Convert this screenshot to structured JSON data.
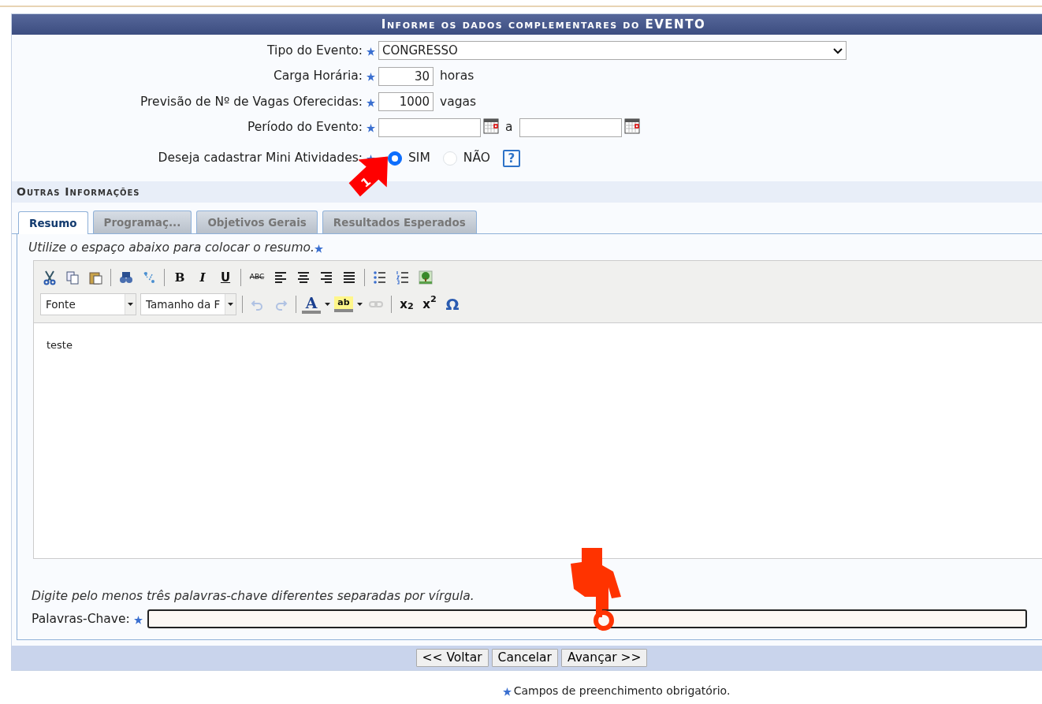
{
  "header": {
    "title": "Informe os dados complementares do EVENTO"
  },
  "fields": [
    {
      "kind": "select",
      "label": "Tipo do Evento:",
      "value": "CONGRESSO"
    },
    {
      "kind": "number",
      "label": "Carga Horária:",
      "value": "30",
      "unit": "horas"
    },
    {
      "kind": "number",
      "label": "Previsão de Nº de Vagas Oferecidas:",
      "value": "1000",
      "unit": "vagas"
    },
    {
      "kind": "daterange",
      "label": "Período do Evento:",
      "separator": "a"
    },
    {
      "kind": "radio",
      "label": "Deseja cadastrar Mini Atividades:",
      "options": [
        {
          "label": "SIM",
          "selected": true
        },
        {
          "label": "NÃO",
          "selected": false
        }
      ],
      "help": "?"
    }
  ],
  "section": {
    "title": "Outras Informações"
  },
  "tabs": [
    {
      "label": "Resumo",
      "selected": true
    },
    {
      "label": "Programaç...",
      "selected": false
    },
    {
      "label": "Objetivos Gerais",
      "selected": false
    },
    {
      "label": "Resultados Esperados",
      "selected": false
    }
  ],
  "editor": {
    "hint": "Utilize o espaço abaixo para colocar o resumo.",
    "toolbar_rows": [
      [
        {
          "kind": "cut",
          "disabled": false
        },
        {
          "kind": "copy",
          "disabled": false
        },
        {
          "kind": "paste",
          "disabled": false
        },
        {
          "kind": "sep"
        },
        {
          "kind": "find",
          "disabled": false
        },
        {
          "kind": "replace",
          "disabled": false
        },
        {
          "kind": "sep"
        },
        {
          "kind": "bold",
          "glyph": "B",
          "disabled": false
        },
        {
          "kind": "italic",
          "glyph": "I",
          "disabled": false
        },
        {
          "kind": "underline",
          "glyph": "U",
          "disabled": false
        },
        {
          "kind": "sep"
        },
        {
          "kind": "strike",
          "glyph": "ABC",
          "disabled": false
        },
        {
          "kind": "align-left",
          "disabled": false
        },
        {
          "kind": "align-center",
          "disabled": false
        },
        {
          "kind": "align-right",
          "disabled": false
        },
        {
          "kind": "justify",
          "disabled": false
        },
        {
          "kind": "sep"
        },
        {
          "kind": "bullets",
          "disabled": false
        },
        {
          "kind": "numbers",
          "disabled": false
        },
        {
          "kind": "image",
          "disabled": false
        }
      ],
      [
        {
          "kind": "dropdown",
          "label": "Fonte"
        },
        {
          "kind": "dropdown",
          "label": "Tamanho da F"
        },
        {
          "kind": "sep"
        },
        {
          "kind": "undo",
          "disabled": true
        },
        {
          "kind": "redo",
          "disabled": true
        },
        {
          "kind": "sep"
        },
        {
          "kind": "text-color",
          "glyph": "A",
          "disabled": false
        },
        {
          "kind": "highlight",
          "glyph": "ab",
          "disabled": false
        },
        {
          "kind": "link",
          "disabled": true
        },
        {
          "kind": "sep"
        },
        {
          "kind": "subscript",
          "glyph": "x$_{2}$",
          "disabled": false
        },
        {
          "kind": "superscript",
          "glyph": "x$^{2}$",
          "disabled": false
        },
        {
          "kind": "special-char",
          "glyph": "Ω",
          "disabled": false
        }
      ]
    ],
    "content": "teste"
  },
  "keywords": {
    "hint": "Digite pelo menos três palavras-chave diferentes separadas por vírgula.",
    "label": "Palavras-Chave:"
  },
  "buttons": [
    "<< Voltar",
    "Cancelar",
    "Avançar >>"
  ],
  "footnote": "Campos de preenchimento obrigatório.",
  "annotations": [
    {
      "kind": "arrow",
      "label": "1"
    },
    {
      "kind": "pointer"
    }
  ]
}
